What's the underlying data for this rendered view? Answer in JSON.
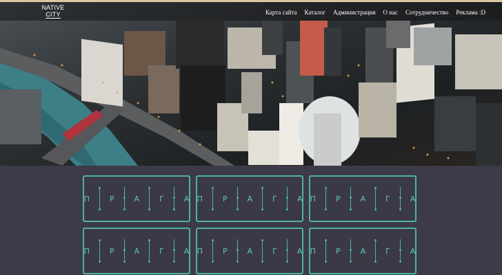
{
  "logo": {
    "line1": "NATIVE",
    "line2": "CITY"
  },
  "nav": [
    "Карта сайта",
    "Каталог",
    "Администрация",
    "О нас",
    "Сотрудничество",
    "Реклама :D"
  ],
  "hero": {
    "icon": "city-aerial-photo"
  },
  "cards": [
    {
      "letters": [
        "П",
        "Р",
        "А",
        "Г",
        "А"
      ]
    },
    {
      "letters": [
        "П",
        "Р",
        "А",
        "Г",
        "А"
      ]
    },
    {
      "letters": [
        "П",
        "Р",
        "А",
        "Г",
        "А"
      ]
    },
    {
      "letters": [
        "П",
        "Р",
        "А",
        "Г",
        "А"
      ]
    },
    {
      "letters": [
        "П",
        "Р",
        "А",
        "Г",
        "А"
      ]
    },
    {
      "letters": [
        "П",
        "Р",
        "А",
        "Г",
        "А"
      ]
    }
  ],
  "colors": {
    "background": "#3d3b47",
    "accent": "#4fb2a8",
    "topbar_border": "#d9c9a3"
  }
}
